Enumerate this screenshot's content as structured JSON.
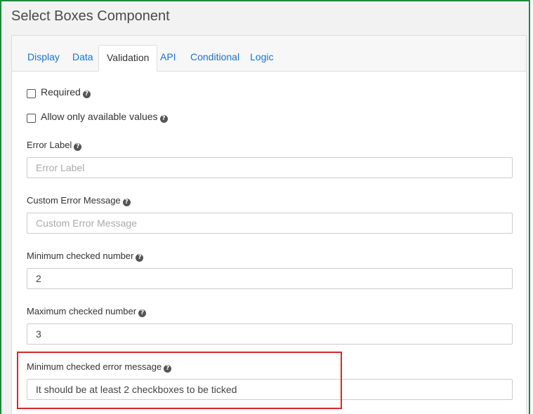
{
  "window": {
    "title": "Select Boxes Component"
  },
  "tabs": [
    {
      "label": "Display",
      "active": false
    },
    {
      "label": "Data",
      "active": false
    },
    {
      "label": "Validation",
      "active": true
    },
    {
      "label": "API",
      "active": false
    },
    {
      "label": "Conditional",
      "active": false
    },
    {
      "label": "Logic",
      "active": false
    }
  ],
  "checkboxes": {
    "required": {
      "label": "Required",
      "checked": false
    },
    "only_available": {
      "label": "Allow only available values",
      "checked": false
    }
  },
  "fields": {
    "error_label": {
      "label": "Error Label",
      "value": "",
      "placeholder": "Error Label"
    },
    "custom_error": {
      "label": "Custom Error Message",
      "value": "",
      "placeholder": "Custom Error Message"
    },
    "min_checked": {
      "label": "Minimum checked number",
      "value": "2"
    },
    "max_checked": {
      "label": "Maximum checked number",
      "value": "3"
    },
    "min_checked_error": {
      "label": "Minimum checked error message",
      "value": "It should be at least 2 checkboxes to be ticked"
    }
  },
  "help_glyph": "?",
  "colors": {
    "frame_border": "#1f8a3b",
    "tab_link": "#1a73c8",
    "highlight": "#d6262c"
  }
}
